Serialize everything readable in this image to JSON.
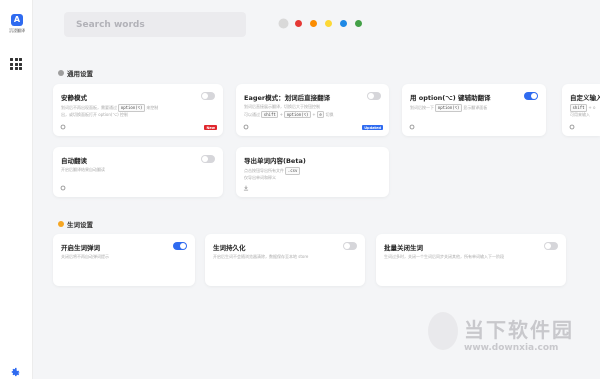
{
  "sidebar": {
    "logo_text": "沉浸翻译",
    "logo_mark": "A"
  },
  "search": {
    "placeholder": "Search words"
  },
  "theme_colors": [
    "#d9d9d9",
    "#e53935",
    "#fb8c00",
    "#fdd835",
    "#1e88e5",
    "#43a047"
  ],
  "section_general": {
    "title": "通用设置",
    "icon_color": "#9e9e9e"
  },
  "section_wordbook": {
    "title": "生词设置",
    "icon_color": "#f5a623"
  },
  "cards": {
    "quiet": {
      "title": "安静模式",
      "desc1_pre": "划词后不再出现面板，需要通过",
      "desc1_kbd": "option(⌥)",
      "desc1_post": "来控制",
      "desc2": "出，或切换面板打开 option(⌥) 控制",
      "badge": "New"
    },
    "eager": {
      "title": "Eager模式：划词后直接翻译",
      "desc1": "划词后直接展示翻译，切换后大于按钮控制",
      "desc2_pre": "可以通过",
      "desc2_k1": "shift",
      "desc2_k2": "option(⌥)",
      "desc2_k3": "e",
      "desc2_post": "切换",
      "badge": "Updated"
    },
    "option": {
      "title": "用 option(⌥) 键辅助翻译",
      "desc1_pre": "划词后按一下",
      "desc1_kbd": "option(⌥)",
      "desc1_post": "显示翻译面板"
    },
    "custom": {
      "title": "自定义输入",
      "desc_k1": "shift",
      "desc_sep": "+ o",
      "desc2": "可用来输入"
    },
    "autosave": {
      "title": "自动翻读",
      "desc": "开启后翻译结果自动翻读"
    },
    "export": {
      "title": "导出单词内容(Beta)",
      "desc1_pre": "点击按钮导出所有文件",
      "desc1_kbd": ".csv",
      "desc2": "仅导出单词和释义"
    },
    "wb_open": {
      "title": "开启生词弹词",
      "desc": "关闭后将不再自动弹词提示"
    },
    "wb_persist": {
      "title": "生词持久化",
      "desc": "开启后生词不会随浏览器清除，数据保存至本地 store"
    },
    "wb_batch": {
      "title": "批量关闭生词",
      "desc": "生词过多时，关闭一个生词后同步关闭其他，所有单词输入下一阶段"
    }
  },
  "watermark": {
    "text": "当下软件园",
    "url": "www.downxia.com"
  }
}
